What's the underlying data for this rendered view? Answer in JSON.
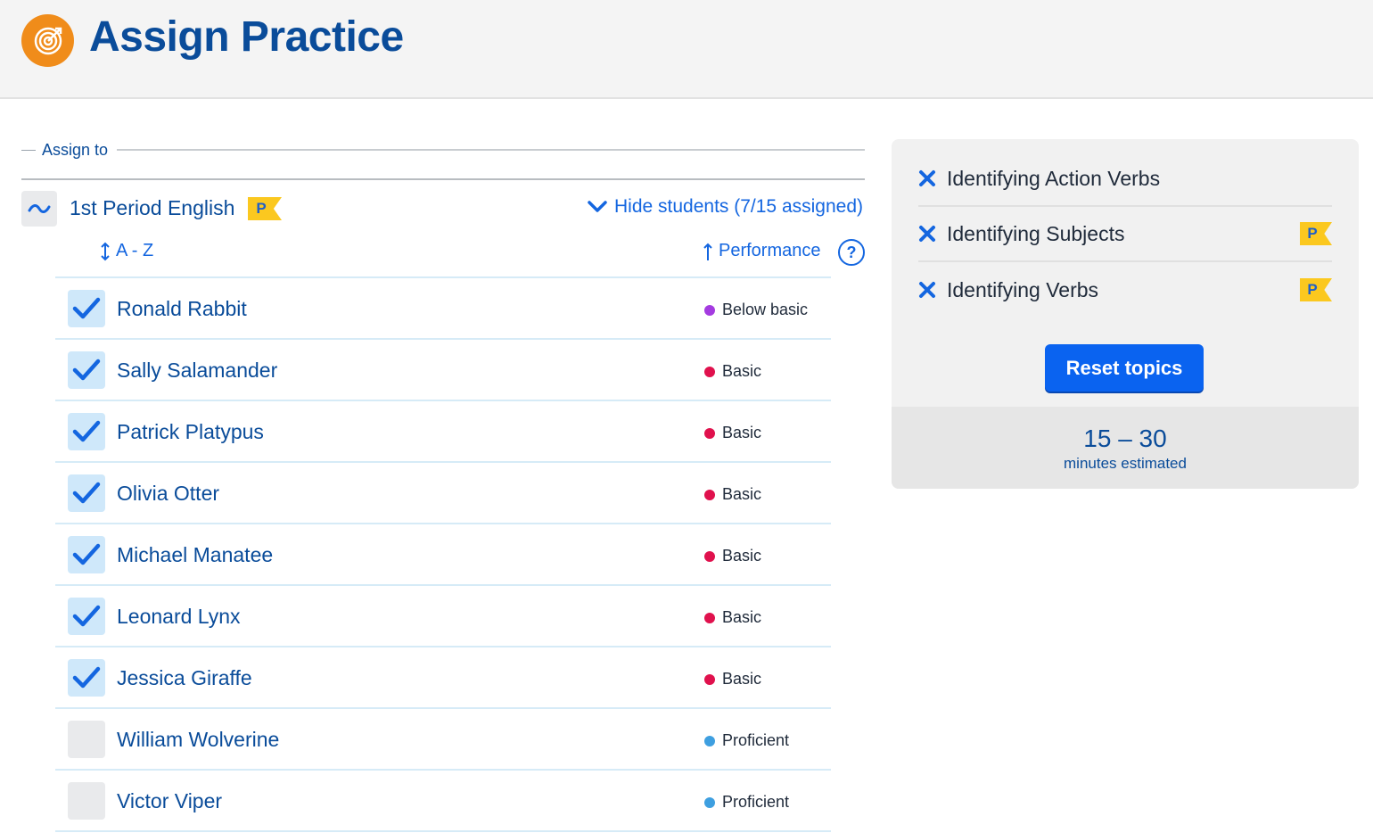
{
  "header": {
    "title": "Assign Practice",
    "logo_icon": "target-icon",
    "logo_color": "#f08c1a"
  },
  "assign": {
    "section_label": "Assign to",
    "class_name": "1st Period English",
    "class_badge": "P",
    "toggle_icon": "tilde-icon",
    "hide_students_label": "Hide students (7/15 assigned)",
    "sort_az_label": "A - Z",
    "sort_performance_label": "Performance",
    "help_label": "?"
  },
  "students": [
    {
      "name": "Ronald Rabbit",
      "checked": true,
      "performance": "Below basic",
      "dot_color": "#a43be0"
    },
    {
      "name": "Sally Salamander",
      "checked": true,
      "performance": "Basic",
      "dot_color": "#e0114d"
    },
    {
      "name": "Patrick Platypus",
      "checked": true,
      "performance": "Basic",
      "dot_color": "#e0114d"
    },
    {
      "name": "Olivia Otter",
      "checked": true,
      "performance": "Basic",
      "dot_color": "#e0114d"
    },
    {
      "name": "Michael Manatee",
      "checked": true,
      "performance": "Basic",
      "dot_color": "#e0114d"
    },
    {
      "name": "Leonard Lynx",
      "checked": true,
      "performance": "Basic",
      "dot_color": "#e0114d"
    },
    {
      "name": "Jessica Giraffe",
      "checked": true,
      "performance": "Basic",
      "dot_color": "#e0114d"
    },
    {
      "name": "William Wolverine",
      "checked": false,
      "performance": "Proficient",
      "dot_color": "#3e9fe0"
    },
    {
      "name": "Victor Viper",
      "checked": false,
      "performance": "Proficient",
      "dot_color": "#3e9fe0"
    }
  ],
  "topics": [
    {
      "name": "Identifying Action Verbs",
      "badge": ""
    },
    {
      "name": "Identifying Subjects",
      "badge": "P"
    },
    {
      "name": "Identifying Verbs",
      "badge": "P"
    }
  ],
  "reset_button_label": "Reset topics",
  "estimate": {
    "range": "15 – 30",
    "label": "minutes estimated"
  },
  "colors": {
    "accent_blue": "#0a63f0",
    "title_blue": "#0a4c9a",
    "badge_yellow": "#fbc81f"
  }
}
